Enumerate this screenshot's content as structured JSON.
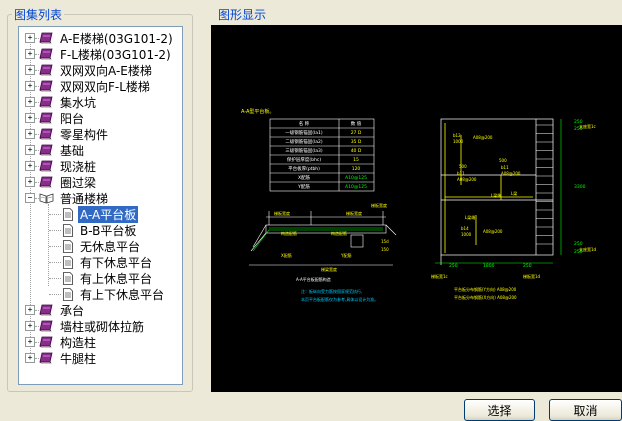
{
  "tree_panel": {
    "title": "图集列表"
  },
  "preview_panel": {
    "title": "图形显示"
  },
  "tree": {
    "items": [
      {
        "label": "A-E楼梯(03G101-2)",
        "type": "folder",
        "expanded": false
      },
      {
        "label": "F-L楼梯(03G101-2)",
        "type": "folder",
        "expanded": false
      },
      {
        "label": "双网双向A-E楼梯",
        "type": "folder",
        "expanded": false
      },
      {
        "label": "双网双向F-L楼梯",
        "type": "folder",
        "expanded": false
      },
      {
        "label": "集水坑",
        "type": "folder",
        "expanded": false
      },
      {
        "label": "阳台",
        "type": "folder",
        "expanded": false
      },
      {
        "label": "零星构件",
        "type": "folder",
        "expanded": false
      },
      {
        "label": "基础",
        "type": "folder",
        "expanded": false
      },
      {
        "label": "现浇桩",
        "type": "folder",
        "expanded": false
      },
      {
        "label": "圈过梁",
        "type": "folder",
        "expanded": false
      },
      {
        "label": "普通楼梯",
        "type": "folder",
        "expanded": true
      },
      {
        "label": "A-A平台板",
        "type": "doc",
        "selected": true
      },
      {
        "label": "B-B平台板",
        "type": "doc"
      },
      {
        "label": "无休息平台",
        "type": "doc"
      },
      {
        "label": "有下休息平台",
        "type": "doc"
      },
      {
        "label": "有上休息平台",
        "type": "doc"
      },
      {
        "label": "有上下休息平台",
        "type": "doc"
      },
      {
        "label": "承台",
        "type": "folder",
        "expanded": false
      },
      {
        "label": "墙柱或砌体拉筋",
        "type": "folder",
        "expanded": false
      },
      {
        "label": "构造柱",
        "type": "folder",
        "expanded": false
      },
      {
        "label": "牛腿柱",
        "type": "folder",
        "expanded": false
      }
    ]
  },
  "drawing": {
    "title": "A-A型平台板。",
    "table": [
      [
        "名 称",
        "数 值"
      ],
      [
        "一级钢筋锚固(la1)",
        "27 D"
      ],
      [
        "二级钢筋锚固(la2)",
        "35 D"
      ],
      [
        "三级钢筋锚固(la3)",
        "40 D"
      ],
      [
        "保护层厚度(bhc)",
        "15"
      ],
      [
        "平台板厚(ptbh)",
        "120"
      ],
      [
        "X配筋",
        "A10@125"
      ],
      [
        "Y配筋",
        "A10@125"
      ]
    ],
    "section_caption": "A-A平台板配筋构造",
    "notes": "注：板纵向受力筋按国家规范执行,\n本页平台板配筋仅为参考,具体以设计为准。",
    "dims": {
      "d250a": "250",
      "d250b": "250",
      "d3300": "3300",
      "d1800": "1800",
      "d250c": "250",
      "d250d": "250"
    },
    "plan_labels": {
      "ab200a": "A08@200",
      "ab200b": "A08@200",
      "bottom1": "平台板分布钢筋(Y方向) A08@200",
      "bottom2": "平台板分布钢筋(X方向) A08@200",
      "stair1": "梯板宽1c",
      "stair2": "梯板宽1d"
    }
  },
  "buttons": {
    "select": "选择",
    "cancel": "取消"
  }
}
